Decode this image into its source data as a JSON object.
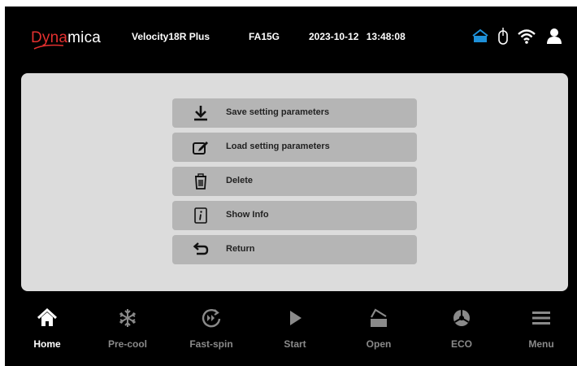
{
  "header": {
    "logo": {
      "part1": "D",
      "part2": "yna",
      "part3": "mica"
    },
    "model": "Velocity18R Plus",
    "code": "FA15G",
    "datetime": "2023-10-12  13:48:08",
    "status_icons": [
      "home-network-icon",
      "mouse-icon",
      "wifi-icon",
      "user-icon"
    ]
  },
  "menu": {
    "items": [
      {
        "label": "Save setting parameters",
        "icon": "download-icon"
      },
      {
        "label": "Load setting parameters",
        "icon": "edit-icon"
      },
      {
        "label": "Delete",
        "icon": "trash-icon"
      },
      {
        "label": "Show Info",
        "icon": "info-icon"
      },
      {
        "label": "Return",
        "icon": "return-icon"
      }
    ]
  },
  "nav": {
    "items": [
      {
        "label": "Home",
        "icon": "home-icon",
        "active": true
      },
      {
        "label": "Pre-cool",
        "icon": "snowflake-icon",
        "active": false
      },
      {
        "label": "Fast-spin",
        "icon": "fast-spin-icon",
        "active": false
      },
      {
        "label": "Start",
        "icon": "play-icon",
        "active": false
      },
      {
        "label": "Open",
        "icon": "open-lid-icon",
        "active": false
      },
      {
        "label": "ECO",
        "icon": "eco-icon",
        "active": false
      },
      {
        "label": "Menu",
        "icon": "hamburger-icon",
        "active": false
      }
    ]
  },
  "colors": {
    "background": "#000000",
    "panel": "#dcdcdc",
    "menu_button": "#b5b5b5",
    "logo_accent": "#e3302f",
    "nav_inactive": "#8a8a8a",
    "nav_active": "#ffffff",
    "status_blue": "#1e90d8"
  }
}
